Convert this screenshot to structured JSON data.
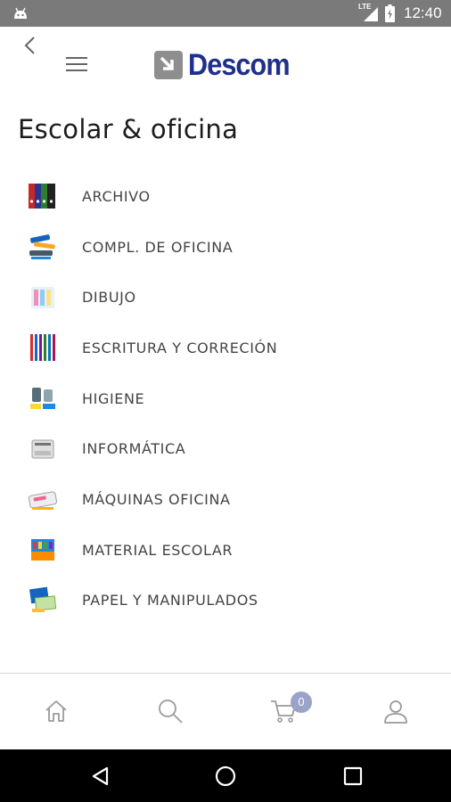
{
  "status_bar": {
    "time": "12:40",
    "network": "LTE",
    "icons": [
      "android-icon",
      "signal-icon",
      "battery-icon"
    ]
  },
  "header": {
    "brand": "Descom",
    "brand_color": "#1f2f8b",
    "icons": [
      "back-arrow-icon",
      "hamburger-menu-icon"
    ]
  },
  "page": {
    "title": "Escolar & oficina"
  },
  "categories": [
    {
      "label": "ARCHIVO",
      "icon": "binders-icon"
    },
    {
      "label": "COMPL. DE OFICINA",
      "icon": "stapler-icon"
    },
    {
      "label": "DIBUJO",
      "icon": "drawing-supplies-icon"
    },
    {
      "label": "ESCRITURA Y CORRECIÓN",
      "icon": "pens-icon"
    },
    {
      "label": "HIGIENE",
      "icon": "hygiene-products-icon"
    },
    {
      "label": "INFORMÁTICA",
      "icon": "printer-icon"
    },
    {
      "label": "MÁQUINAS OFICINA",
      "icon": "office-machine-icon"
    },
    {
      "label": "MATERIAL ESCOLAR",
      "icon": "school-supplies-icon"
    },
    {
      "label": "PAPEL Y MANIPULADOS",
      "icon": "paper-products-icon"
    }
  ],
  "bottom_nav": {
    "items": [
      "home-icon",
      "search-icon",
      "cart-icon",
      "user-icon"
    ],
    "cart_count": "0",
    "badge_color": "#9aa3c8"
  },
  "android_nav": {
    "items": [
      "back-triangle-icon",
      "home-circle-icon",
      "recents-square-icon"
    ]
  }
}
